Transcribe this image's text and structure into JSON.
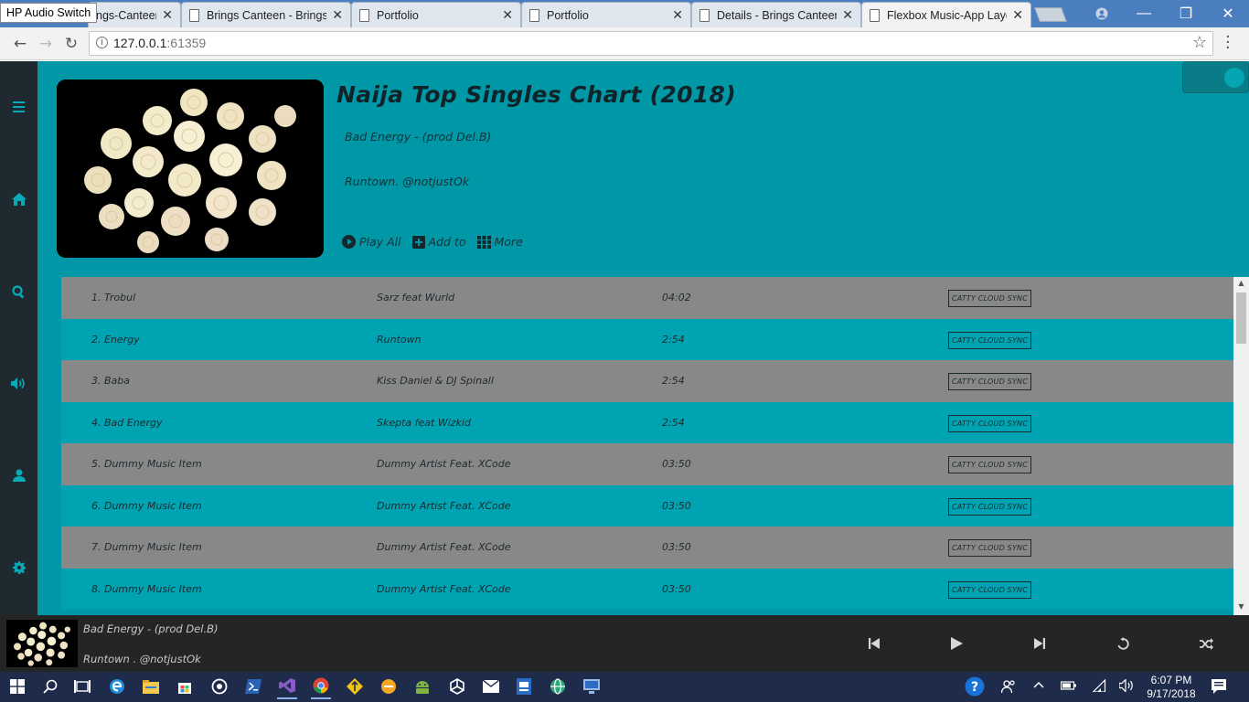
{
  "browser": {
    "tooltip": "HP Audio Switch",
    "tabs": [
      {
        "title": "ngs-Canteen"
      },
      {
        "title": "Brings Canteen - Brings"
      },
      {
        "title": "Portfolio"
      },
      {
        "title": "Portfolio"
      },
      {
        "title": "Details - Brings Canteen"
      },
      {
        "title": "Flexbox Music-App Layo"
      }
    ],
    "url_host": "127.0.0.1",
    "url_port": ":61359"
  },
  "header": {
    "title": "Naija Top Singles Chart (2018)",
    "song": "Bad Energy - (prod Del.B)",
    "artist": "Runtown. @notjustOk",
    "actions": {
      "play_all": "Play All",
      "add_to": "Add to",
      "more": "More"
    }
  },
  "tracks": [
    {
      "title": "1. Trobul",
      "artist": "Sarz feat Wurld",
      "duration": "04:02",
      "sync": "CATTY CLOUD SYNC"
    },
    {
      "title": "2. Energy",
      "artist": "Runtown",
      "duration": "2:54",
      "sync": "CATTY CLOUD SYNC"
    },
    {
      "title": "3. Baba",
      "artist": "Kiss Daniel & DJ Spinall",
      "duration": "2:54",
      "sync": "CATTY CLOUD SYNC"
    },
    {
      "title": "4. Bad Energy",
      "artist": "Skepta feat Wizkid",
      "duration": "2:54",
      "sync": "CATTY CLOUD SYNC"
    },
    {
      "title": "5. Dummy Music Item",
      "artist": "Dummy Artist Feat. XCode",
      "duration": "03:50",
      "sync": "CATTY CLOUD SYNC"
    },
    {
      "title": "6. Dummy Music Item",
      "artist": "Dummy Artist Feat. XCode",
      "duration": "03:50",
      "sync": "CATTY CLOUD SYNC"
    },
    {
      "title": "7. Dummy Music Item",
      "artist": "Dummy Artist Feat. XCode",
      "duration": "03:50",
      "sync": "CATTY CLOUD SYNC"
    },
    {
      "title": "8. Dummy Music Item",
      "artist": "Dummy Artist Feat. XCode",
      "duration": "03:50",
      "sync": "CATTY CLOUD SYNC"
    }
  ],
  "now_playing": {
    "song": "Bad Energy - (prod Del.B)",
    "artist": "Runtown . @notjustOk"
  },
  "taskbar": {
    "time": "6:07 PM",
    "date": "9/17/2018"
  },
  "colors": {
    "accent": "#0097a7",
    "row_gray": "#888888",
    "row_teal": "#00a3b1",
    "sidebar": "#1f2a30",
    "player": "#252525"
  }
}
